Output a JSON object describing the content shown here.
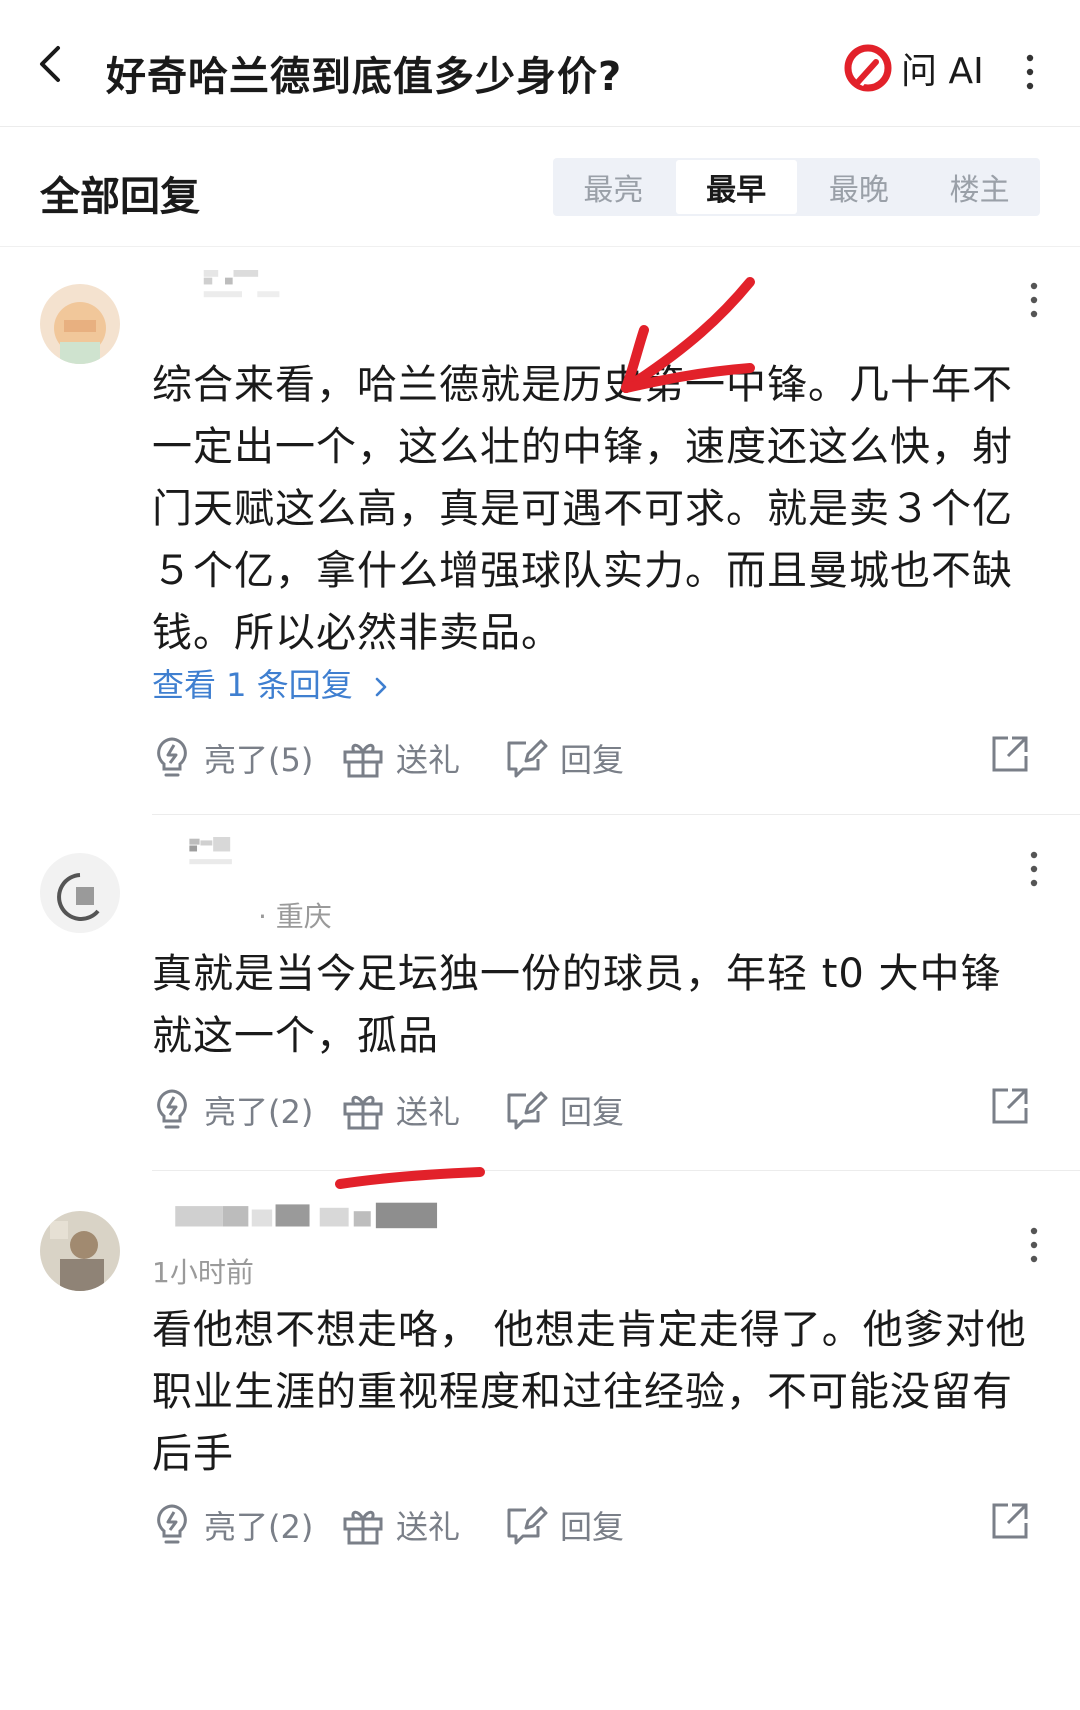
{
  "header": {
    "title": "好奇哈兰德到底值多少身价?",
    "ask_ai": "问 AI"
  },
  "sort": {
    "section_title": "全部回复",
    "options": [
      "最亮",
      "最早",
      "最晚",
      "楼主"
    ],
    "selected": "最早"
  },
  "comments": [
    {
      "meta": "",
      "content": "综合来看，哈兰德就是历史第一中锋。几十年不一定出一个，这么壮的中锋，速度还这么快，射门天赋这么高，真是可遇不可求。就是卖３个亿５个亿，拿什么增强球队实力。而且曼城也不缺钱。所以必然非卖品。",
      "view_replies": "查看 1 条回复",
      "like": "亮了(5)",
      "gift": "送礼",
      "reply": "回复"
    },
    {
      "meta": "· 重庆",
      "content": "真就是当今足坛独一份的球员，年轻 t0 大中锋就这一个，孤品",
      "like": "亮了(2)",
      "gift": "送礼",
      "reply": "回复"
    },
    {
      "meta": "1小时前",
      "content": "看他想不想走咯，  他想走肯定走得了。他爹对他职业生涯的重视程度和过往经验，不可能没留有后手",
      "like": "亮了(2)",
      "gift": "送礼",
      "reply": "回复"
    }
  ],
  "colors": {
    "link": "#3f7fd0",
    "annotation": "#e2212a",
    "segment_bg": "#eef1f7",
    "action_gray": "#7a7f88"
  },
  "icons": [
    "back-arrow-icon",
    "ask-ai-logo-icon",
    "more-vertical-icon",
    "lightbulb-icon",
    "gift-icon",
    "reply-edit-icon",
    "share-icon",
    "chevron-right-icon"
  ]
}
